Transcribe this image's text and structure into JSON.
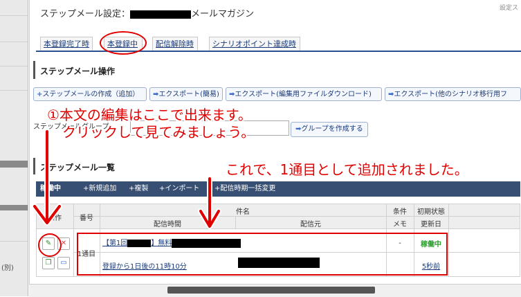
{
  "left_panel": {
    "label": "(別)"
  },
  "header": {
    "title_prefix": "ステップメール設定：",
    "title_suffix": "メールマガジン",
    "settings_label": "設定ス"
  },
  "tabs": [
    {
      "label": "本登録完了時"
    },
    {
      "label": "本登録中"
    },
    {
      "label": "配信解除時"
    },
    {
      "label": "シナリオポイント達成時"
    }
  ],
  "operations": {
    "title": "ステップメール操作",
    "buttons": [
      {
        "label": "ステップメールの作成（追加）"
      },
      {
        "label": "エクスポート(簡易)"
      },
      {
        "label": "エクスポート(編集用ファイルダウンロード)"
      },
      {
        "label": "エクスポート(他のシナリオ移行用フ"
      }
    ],
    "group_label": "ステップメールグループ",
    "create_group_button": "グループを作成する"
  },
  "list": {
    "title": "ステップメール一覧",
    "toolbar": [
      {
        "label": "稼働中"
      },
      {
        "label": "新規追加"
      },
      {
        "label": "複製"
      },
      {
        "label": "インポート"
      },
      {
        "label": "配信時期一括変更"
      }
    ],
    "headers": {
      "operation": "操作",
      "number": "番号",
      "subject": "件名",
      "send_time": "配信時間",
      "sender": "配信元",
      "condition": "条件",
      "memo": "メモ",
      "initial_state": "初期状態",
      "updated": "更新日"
    },
    "rows": [
      {
        "number": "1通目",
        "subject_prefix": "【第1回",
        "subject_mid": "】無料",
        "send_time": "登録から1日後の11時10分",
        "condition": "-",
        "status": "稼働中",
        "updated": "5秒前"
      }
    ]
  },
  "annotations": {
    "line1": "①本文の編集はここで出来ます。",
    "line2": "クリックして見てみましょう。",
    "line3": "これで、1通目として追加されました。"
  },
  "colors": {
    "annotation": "#e00000",
    "status_active": "#2a9d2a",
    "link": "#1a3a7a",
    "toolbar_bg": "#374f72"
  }
}
